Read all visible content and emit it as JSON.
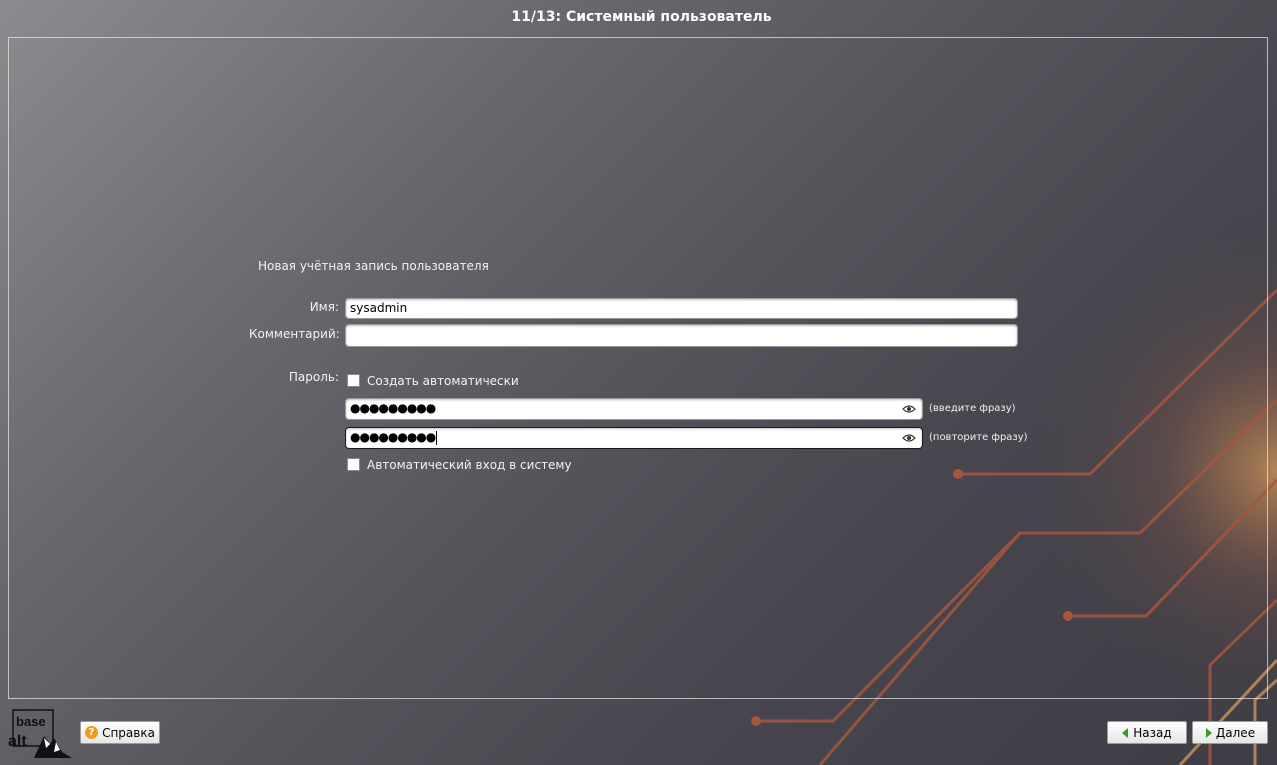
{
  "window": {
    "title": "11/13: Системный пользователь"
  },
  "form": {
    "section_title": "Новая учётная запись пользователя",
    "name": {
      "label": "Имя:",
      "value": "sysadmin"
    },
    "comment": {
      "label": "Комментарий:",
      "value": ""
    },
    "password": {
      "label": "Пароль:",
      "auto_create_label": "Создать автоматически",
      "auto_create_checked": false,
      "field1_value": "●●●●●●●●●",
      "field1_hint": "(введите фразу)",
      "field2_value": "●●●●●●●●●",
      "field2_hint": "(повторите фразу)"
    },
    "autologin": {
      "label": "Автоматический вход в систему",
      "checked": false
    }
  },
  "footer": {
    "logo_text_top": "base",
    "logo_text_bottom": "alt",
    "help_label": "Справка",
    "back_label": "Назад",
    "next_label": "Далее"
  },
  "icons": {
    "help": "question-circle-icon",
    "back": "arrow-left-icon",
    "next": "arrow-right-icon",
    "reveal": "eye-icon"
  },
  "colors": {
    "accent_orange": "#f39a1e",
    "arrow_green": "#3a9a2a",
    "circuit_lines": "#a85a45"
  }
}
